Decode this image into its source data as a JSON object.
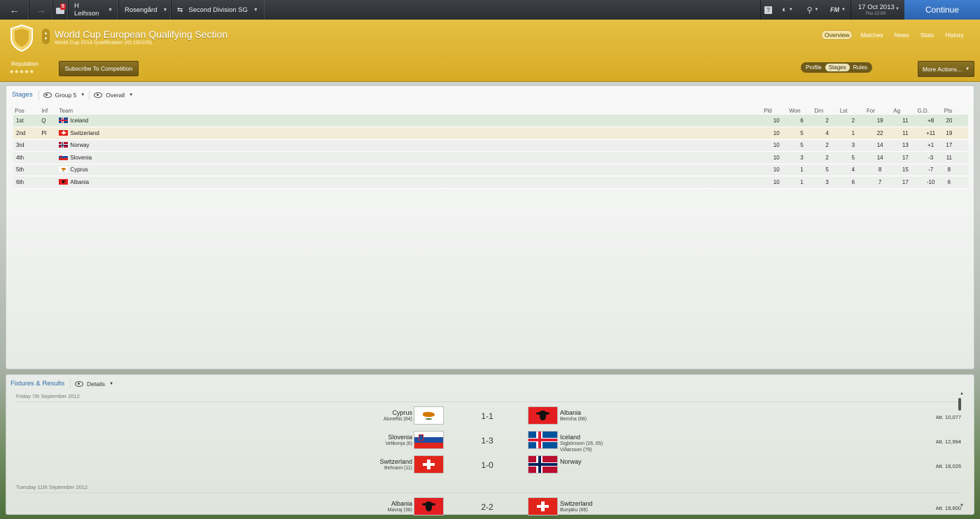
{
  "topbar": {
    "manager": "H Leifsson",
    "club": "Rosengård",
    "division": "Second Division SG",
    "inbox_count": "5",
    "date": "17 Oct 2013",
    "time": "Thu 12:00",
    "continue_label": "Continue",
    "fm_label": "FM"
  },
  "competition": {
    "title": "World Cup European Qualifying Section",
    "subtitle": "World Cup 2014 Qualification (ID:100105)",
    "reputation_label": "Reputation",
    "reputation_stars": "★★★★★",
    "subscribe_label": "Subscribe To Competition",
    "more_actions_label": "More Actions...",
    "tabs": [
      "Overview",
      "Matches",
      "News",
      "Stats",
      "History"
    ],
    "active_tab": "Overview",
    "subtabs": [
      "Profile",
      "Stages",
      "Rules"
    ],
    "active_subtab": "Stages"
  },
  "stages": {
    "title": "Stages",
    "group_label": "Group 5",
    "view_label": "Overall",
    "columns": [
      "Pos",
      "Inf",
      "Team",
      "Pld",
      "Won",
      "Drn",
      "Lst",
      "For",
      "Ag",
      "G.D.",
      "Pts"
    ],
    "rows": [
      {
        "pos": "1st",
        "inf": "Q",
        "team": "Iceland",
        "flag": "iceland",
        "pld": "10",
        "won": "6",
        "drn": "2",
        "lst": "2",
        "for": "19",
        "ag": "11",
        "gd": "+8",
        "pts": "20"
      },
      {
        "pos": "2nd",
        "inf": "Pl",
        "team": "Switzerland",
        "flag": "switzerland",
        "pld": "10",
        "won": "5",
        "drn": "4",
        "lst": "1",
        "for": "22",
        "ag": "11",
        "gd": "+11",
        "pts": "19"
      },
      {
        "pos": "3rd",
        "inf": "",
        "team": "Norway",
        "flag": "norway",
        "pld": "10",
        "won": "5",
        "drn": "2",
        "lst": "3",
        "for": "14",
        "ag": "13",
        "gd": "+1",
        "pts": "17"
      },
      {
        "pos": "4th",
        "inf": "",
        "team": "Slovenia",
        "flag": "slovenia",
        "pld": "10",
        "won": "3",
        "drn": "2",
        "lst": "5",
        "for": "14",
        "ag": "17",
        "gd": "-3",
        "pts": "11"
      },
      {
        "pos": "5th",
        "inf": "",
        "team": "Cyprus",
        "flag": "cyprus",
        "pld": "10",
        "won": "1",
        "drn": "5",
        "lst": "4",
        "for": "8",
        "ag": "15",
        "gd": "-7",
        "pts": "8"
      },
      {
        "pos": "6th",
        "inf": "",
        "team": "Albania",
        "flag": "albania",
        "pld": "10",
        "won": "1",
        "drn": "3",
        "lst": "6",
        "for": "7",
        "ag": "17",
        "gd": "-10",
        "pts": "6"
      }
    ]
  },
  "fixtures": {
    "title": "Fixtures & Results",
    "view_label": "Details",
    "dates": [
      "Friday 7th September 2012",
      "Tuesday 11th September 2012"
    ],
    "matches": [
      {
        "home": "Cyprus",
        "home_flag": "cyprus",
        "home_scorers": "Aloneftis (64)",
        "score": "1-1",
        "away": "Albania",
        "away_flag": "albania",
        "away_scorers": [
          "Berisha (68)"
        ],
        "attendance": "Att. 10,077"
      },
      {
        "home": "Slovenia",
        "home_flag": "slovenia",
        "home_scorers": "Velikonja (6)",
        "score": "1-3",
        "away": "Iceland",
        "away_flag": "iceland",
        "away_scorers": [
          "Sigþórsson (26, 65)",
          "Viðarsson (79)"
        ],
        "attendance": "Att. 12,994"
      },
      {
        "home": "Switzerland",
        "home_flag": "switzerland",
        "home_scorers": "Behrami (11)",
        "score": "1-0",
        "away": "Norway",
        "away_flag": "norway",
        "away_scorers": [],
        "attendance": "Att. 18,026"
      },
      {
        "home": "Albania",
        "home_flag": "albania",
        "home_scorers": "Mavraj (38)",
        "score": "2-2",
        "away": "Switzerland",
        "away_flag": "switzerland",
        "away_scorers": [
          "Bunjaku (66)"
        ],
        "attendance": "Att. 19,600"
      }
    ]
  },
  "colors": {
    "header_gold": "#dcb22f",
    "continue_blue": "#3573c4",
    "link_blue": "#2b6aa8",
    "winner_row": "#dfeadc",
    "playoff_row": "#f3ecd8"
  }
}
